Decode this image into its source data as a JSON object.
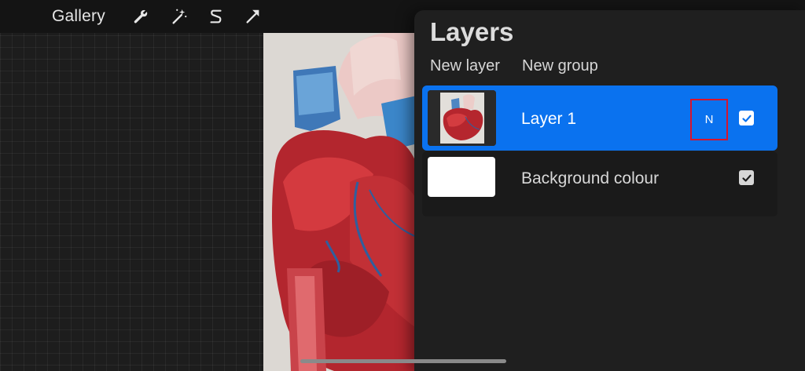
{
  "toolbar": {
    "gallery_label": "Gallery",
    "tools": [
      {
        "icon": "wrench-icon"
      },
      {
        "icon": "magic-wand-icon"
      },
      {
        "icon": "selection-s-icon"
      },
      {
        "icon": "transform-arrow-icon"
      }
    ]
  },
  "layers_panel": {
    "title": "Layers",
    "new_layer_label": "New layer",
    "new_group_label": "New group",
    "layers": [
      {
        "name": "Layer 1",
        "blend_mode": "N",
        "visible": true,
        "selected": true,
        "thumbnail": "heart-illustration"
      },
      {
        "name": "Background colour",
        "visible": true,
        "selected": false,
        "thumbnail": "white-fill"
      }
    ]
  },
  "colors": {
    "accent": "#0a72ef",
    "highlight_border": "#d8142c",
    "panel_bg": "#1f1f1f",
    "toolbar_bg": "#141414"
  }
}
